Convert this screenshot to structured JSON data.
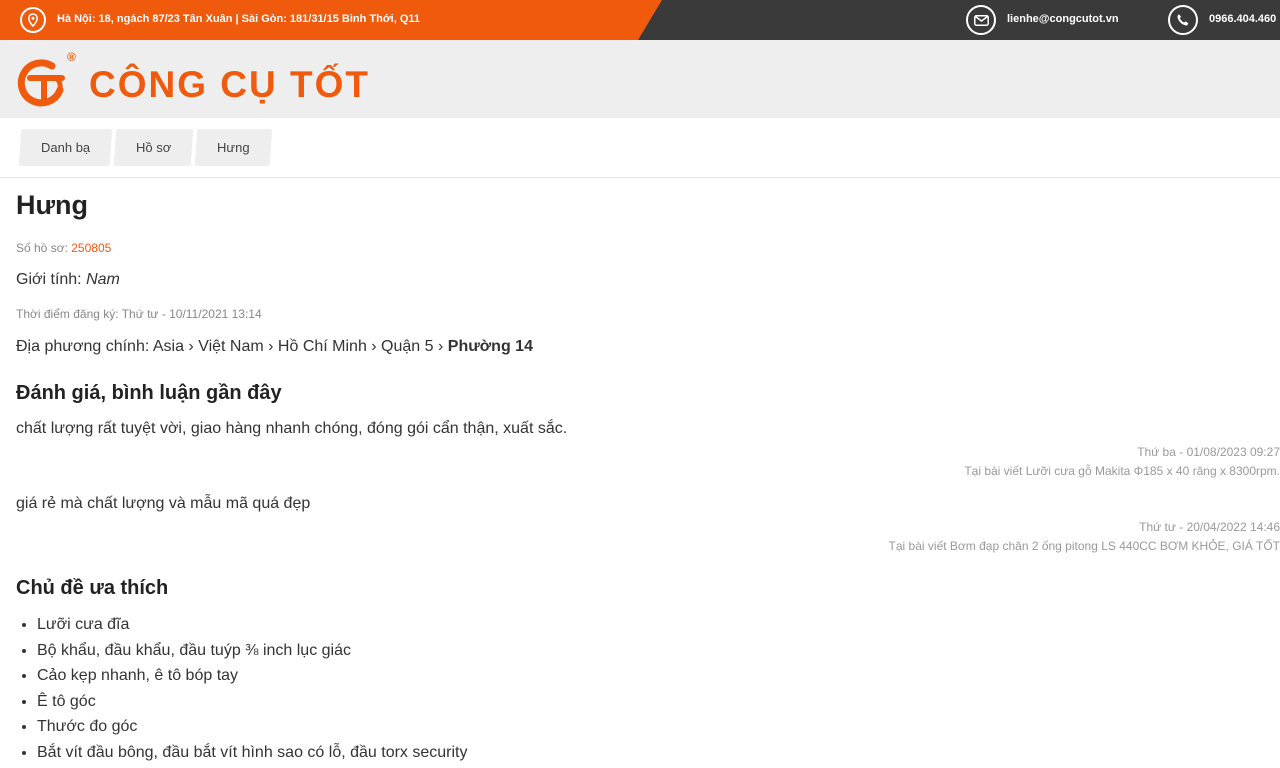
{
  "topbar": {
    "address": "Hà Nội: 18, ngách 87/23 Tân Xuân | Sài Gòn: 181/31/15 Bình Thới, Q11",
    "email": "lienhe@congcutot.vn",
    "phone": "0966.404.460",
    "icons": [
      "location-icon",
      "mail-icon",
      "phone-icon"
    ]
  },
  "brand": {
    "name": "CÔNG CỤ TỐT",
    "registered_mark": "®",
    "color": "#ef5a0d"
  },
  "breadcrumb": [
    "Danh bạ",
    "Hồ sơ",
    "Hưng"
  ],
  "profile": {
    "name": "Hưng",
    "profile_no_label": "Số hồ sơ:",
    "profile_no": "250805",
    "gender_label": "Giới tính:",
    "gender": "Nam",
    "registered_label": "Thời điểm đăng ký:",
    "registered": "Thứ tư - 10/11/2021 13:14",
    "region_label": "Địa phương chính:",
    "region_path": "Asia › Việt Nam › Hồ Chí Minh › Quận 5 ›",
    "region_last": "Phường 14"
  },
  "reviews": {
    "heading": "Đánh giá, bình luận gần đây",
    "items": [
      {
        "text": "chất lượng rất tuyệt vời, giao hàng nhanh chóng, đóng gói cẩn thận, xuất sắc.",
        "date": "Thứ ba - 01/08/2023 09:27",
        "article": "Tại bài viết Lưỡi cưa gỗ Makita Φ185 x 40 răng x 8300rpm."
      },
      {
        "text": "giá rẻ mà chất lượng và mẫu mã quá đẹp",
        "date": "Thứ tư - 20/04/2022 14:46",
        "article": "Tại bài viết Bơm đạp chân 2 ống pitong LS 440CC BƠM KHỎE, GIÁ TỐT"
      }
    ]
  },
  "topics": {
    "heading": "Chủ đề ưa thích",
    "items": [
      "Lưỡi cưa đĩa",
      "Bộ khẩu, đầu khẩu, đầu tuýp ⅜ inch lục giác",
      "Cảo kẹp nhanh, ê tô bóp tay",
      "Ê tô góc",
      "Thước đo góc",
      "Bắt vít đầu bông, đầu bắt vít hình sao có lỗ, đầu torx security"
    ]
  }
}
